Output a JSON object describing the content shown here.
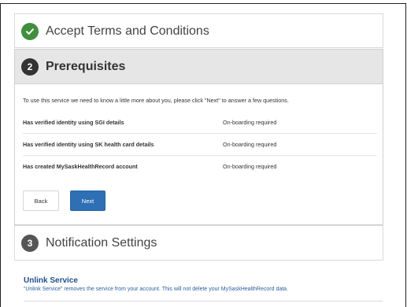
{
  "steps": {
    "step1": {
      "title": "Accept Terms and Conditions",
      "icon": "checkmark-icon",
      "status": "complete",
      "color": "#3f8f3c"
    },
    "step2": {
      "number": "2",
      "title": "Prerequisites",
      "status": "active"
    },
    "step3": {
      "number": "3",
      "title": "Notification Settings",
      "status": "pending"
    }
  },
  "prerequisites": {
    "intro": "To use this service we need to know a little more about you, please click \"Next\" to answer a few questions.",
    "rows": [
      {
        "label": "Has verified identity using SGI details",
        "status": "On-boarding required"
      },
      {
        "label": "Has verified identity using SK health card details",
        "status": "On-boarding required"
      },
      {
        "label": "Has created MySaskHealthRecord account",
        "status": "On-boarding required"
      }
    ],
    "back_label": "Back",
    "next_label": "Next"
  },
  "unlink": {
    "title": "Unlink Service",
    "description": "“Unlink Service” removes the service from your account. This will not delete your MySaskHealthRecord data."
  },
  "colors": {
    "primary": "#2e6fb5",
    "link": "#1f4e8c",
    "success": "#3f8f3c"
  }
}
